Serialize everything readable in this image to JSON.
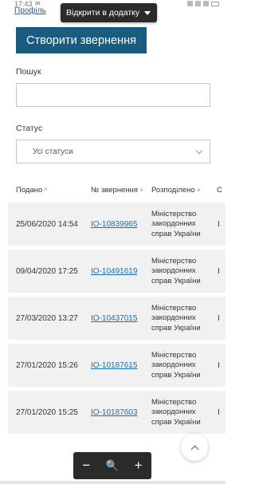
{
  "status": {
    "time": "17:43",
    "mail_icon": "mail-icon"
  },
  "header": {
    "profile_link": "Профіль",
    "open_in_app": "Відкрити в додатку"
  },
  "actions": {
    "create_label": "Створити звернення"
  },
  "filters": {
    "search_label": "Пошук",
    "search_value": "",
    "status_label": "Статус",
    "status_value": "Усі статуси"
  },
  "table": {
    "columns": [
      {
        "label": "Подано",
        "arrow": "^"
      },
      {
        "label": "№ звернення",
        "arrow": "˅"
      },
      {
        "label": "Розподілено",
        "arrow": "˅"
      },
      {
        "label": "С"
      }
    ],
    "rows": [
      {
        "date": "25/06/2020 14:54",
        "number": "IO-10839965",
        "dest": "Міністерство закордонних справ України",
        "extra": "I"
      },
      {
        "date": "09/04/2020 17:25",
        "number": "IO-10491619",
        "dest": "Міністерство закордонних справ України",
        "extra": "I"
      },
      {
        "date": "27/03/2020 13:27",
        "number": "IO-10437015",
        "dest": "Міністерство закордонних справ України",
        "extra": "I"
      },
      {
        "date": "27/01/2020 15:26",
        "number": "IO-10187615",
        "dest": "Міністерство закордонних справ України",
        "extra": "I"
      },
      {
        "date": "27/01/2020 15:25",
        "number": "IO-10187603",
        "dest": "Міністерство закордонних справ України",
        "extra": "I"
      }
    ]
  },
  "zoom": {
    "minus": "−",
    "zoom": "🔍",
    "plus": "+"
  },
  "colors": {
    "primary": "#195c80",
    "link": "#1f6ea8",
    "row_bg": "#f1f1f1"
  }
}
